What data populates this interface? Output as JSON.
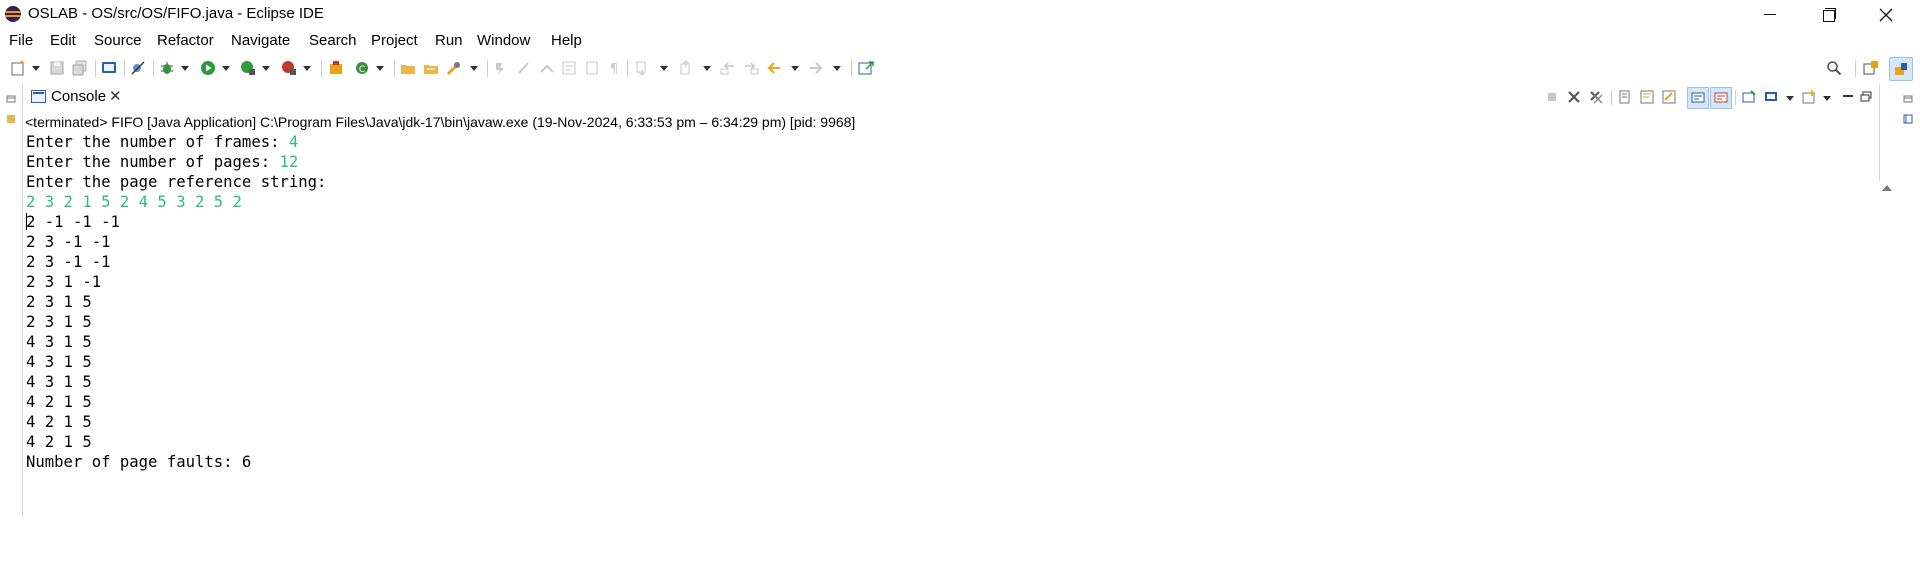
{
  "window": {
    "title": "OSLAB - OS/src/OS/FIFO.java - Eclipse IDE",
    "minimize_label": "—",
    "close_label": "✕"
  },
  "menu": [
    "File",
    "Edit",
    "Source",
    "Refactor",
    "Navigate",
    "Search",
    "Project",
    "Run",
    "Window",
    "Help"
  ],
  "console_view": {
    "tab_label": "Console",
    "tab_close": "✕",
    "status": "<terminated> FIFO [Java Application] C:\\Program Files\\Java\\jdk-17\\bin\\javaw.exe  (19-Nov-2024, 6:33:53 pm – 6:34:29 pm) [pid: 9968]",
    "lines": [
      {
        "prompt": "Enter the number of frames: ",
        "input": "4"
      },
      {
        "prompt": "Enter the number of pages: ",
        "input": "12"
      },
      {
        "prompt": "Enter the page reference string:",
        "input": ""
      },
      {
        "prompt": "",
        "input": "2 3 2 1 5 2 4 5 3 2 5 2"
      },
      {
        "prompt": "2 -1 -1 -1",
        "input": ""
      },
      {
        "prompt": "2 3 -1 -1",
        "input": ""
      },
      {
        "prompt": "2 3 -1 -1",
        "input": ""
      },
      {
        "prompt": "2 3 1 -1",
        "input": ""
      },
      {
        "prompt": "2 3 1 5",
        "input": ""
      },
      {
        "prompt": "2 3 1 5",
        "input": ""
      },
      {
        "prompt": "4 3 1 5",
        "input": ""
      },
      {
        "prompt": "4 3 1 5",
        "input": ""
      },
      {
        "prompt": "4 3 1 5",
        "input": ""
      },
      {
        "prompt": "4 2 1 5",
        "input": ""
      },
      {
        "prompt": "4 2 1 5",
        "input": ""
      },
      {
        "prompt": "4 2 1 5",
        "input": ""
      },
      {
        "prompt": "Number of page faults: 6",
        "input": ""
      }
    ]
  },
  "colors": {
    "input_text": "#2fbd7f",
    "eclipse_logo": "#2c2255",
    "eclipse_logo_stripe": "#f7941e"
  }
}
